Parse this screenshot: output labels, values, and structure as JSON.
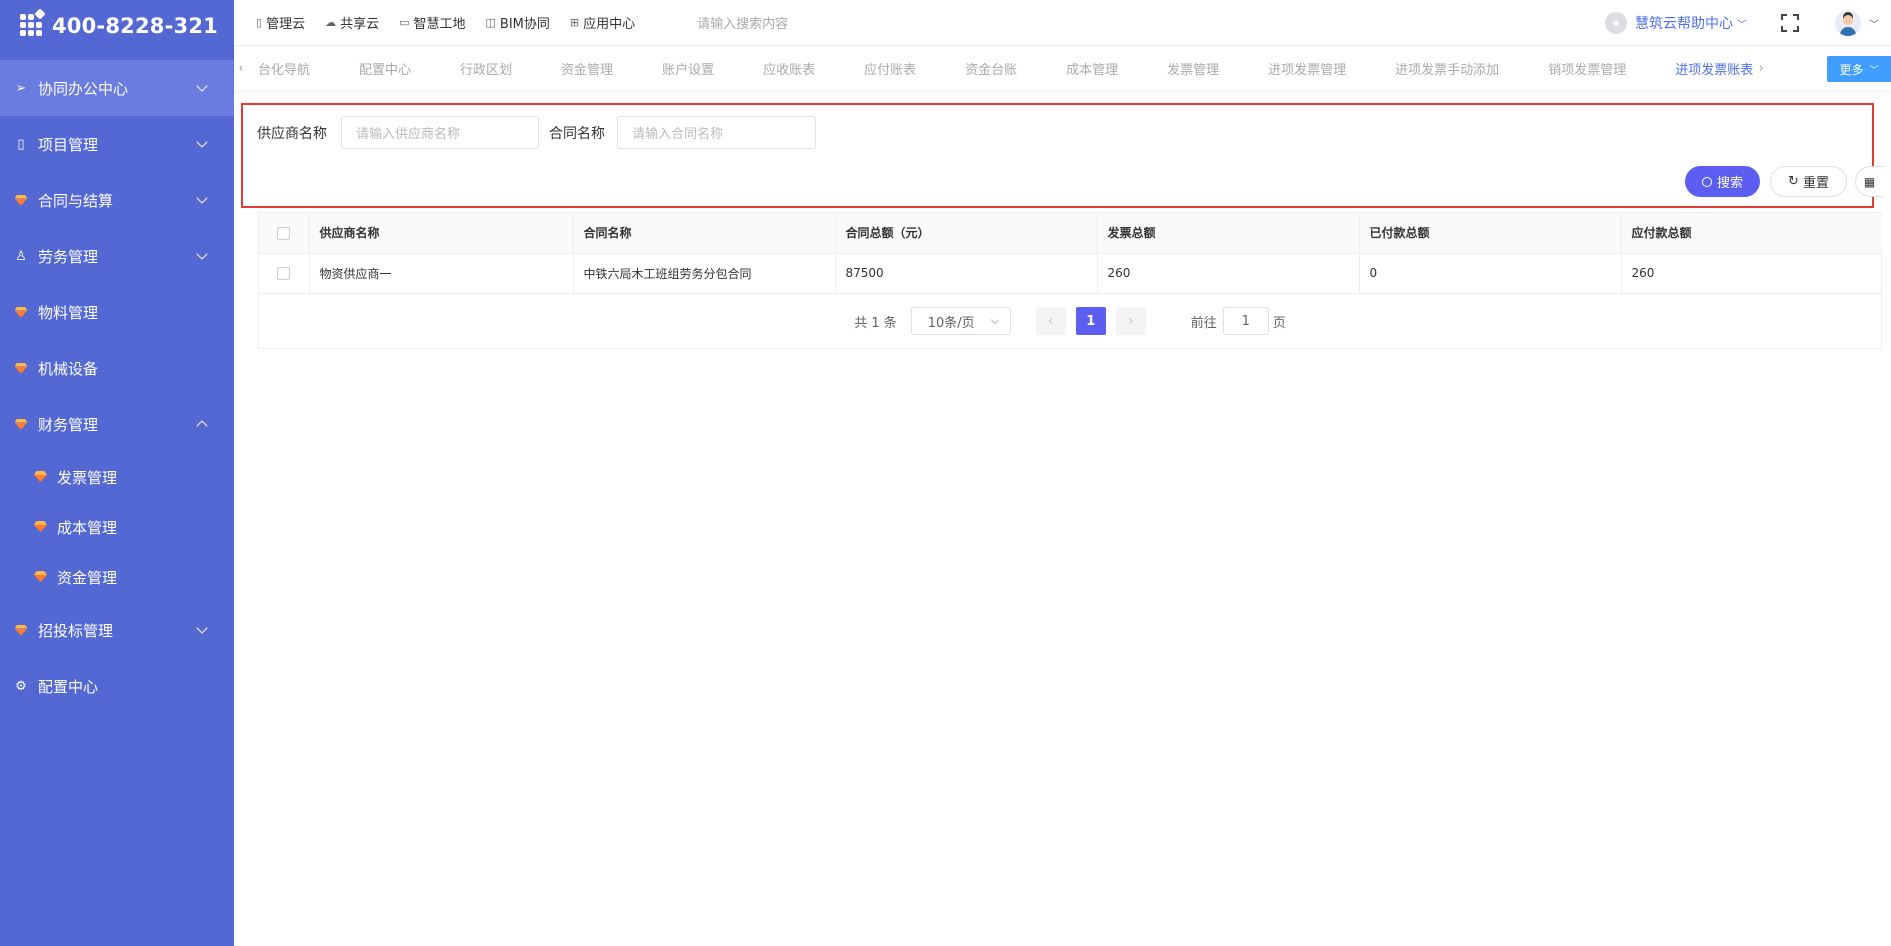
{
  "app": {
    "phone": "400-8228-321"
  },
  "sidebar": {
    "items": [
      {
        "label": "协同办公中心",
        "icon": "send-icon"
      },
      {
        "label": "项目管理",
        "icon": "book-icon"
      },
      {
        "label": "合同与结算",
        "icon": "gem-icon"
      },
      {
        "label": "劳务管理",
        "icon": "user-icon"
      },
      {
        "label": "物料管理",
        "icon": "gem-icon"
      },
      {
        "label": "机械设备",
        "icon": "gem-icon"
      },
      {
        "label": "财务管理",
        "icon": "gem-icon"
      },
      {
        "label": "招投标管理",
        "icon": "gem-icon"
      },
      {
        "label": "配置中心",
        "icon": "gear-icon"
      }
    ],
    "sub_items": [
      "发票管理",
      "成本管理",
      "资金管理"
    ]
  },
  "topbar": {
    "links": [
      "管理云",
      "共享云",
      "智慧工地",
      "BIM协同",
      "应用中心"
    ],
    "search_placeholder": "请输入搜索内容",
    "help": "慧筑云帮助中心"
  },
  "tabs": {
    "items": [
      "台化导航",
      "配置中心",
      "行政区划",
      "资金管理",
      "账户设置",
      "应收账表",
      "应付账表",
      "资金台账",
      "成本管理",
      "发票管理",
      "进项发票管理",
      "进项发票手动添加",
      "销项发票管理",
      "进项发票账表"
    ],
    "active_index": 13,
    "more": "更多"
  },
  "filters": {
    "supplier_label": "供应商名称",
    "supplier_placeholder": "请输入供应商名称",
    "contract_label": "合同名称",
    "contract_placeholder": "请输入合同名称",
    "search_btn": "搜索",
    "reset_btn": "重置"
  },
  "table": {
    "columns": [
      "供应商名称",
      "合同名称",
      "合同总额（元）",
      "发票总额",
      "已付款总额",
      "应付款总额"
    ],
    "rows": [
      [
        "物资供应商一",
        "中铁六局木工班组劳务分包合同",
        "87500",
        "260",
        "0",
        "260"
      ]
    ]
  },
  "pagination": {
    "total": "共 1 条",
    "page_size": "10条/页",
    "current": "1",
    "goto_label": "前往",
    "goto_value": "1",
    "page_unit": "页"
  },
  "colors": {
    "sidebar": "#5468d4",
    "accent": "#5b5ef0",
    "highlight_border": "#e53935",
    "more_btn": "#409eff"
  }
}
